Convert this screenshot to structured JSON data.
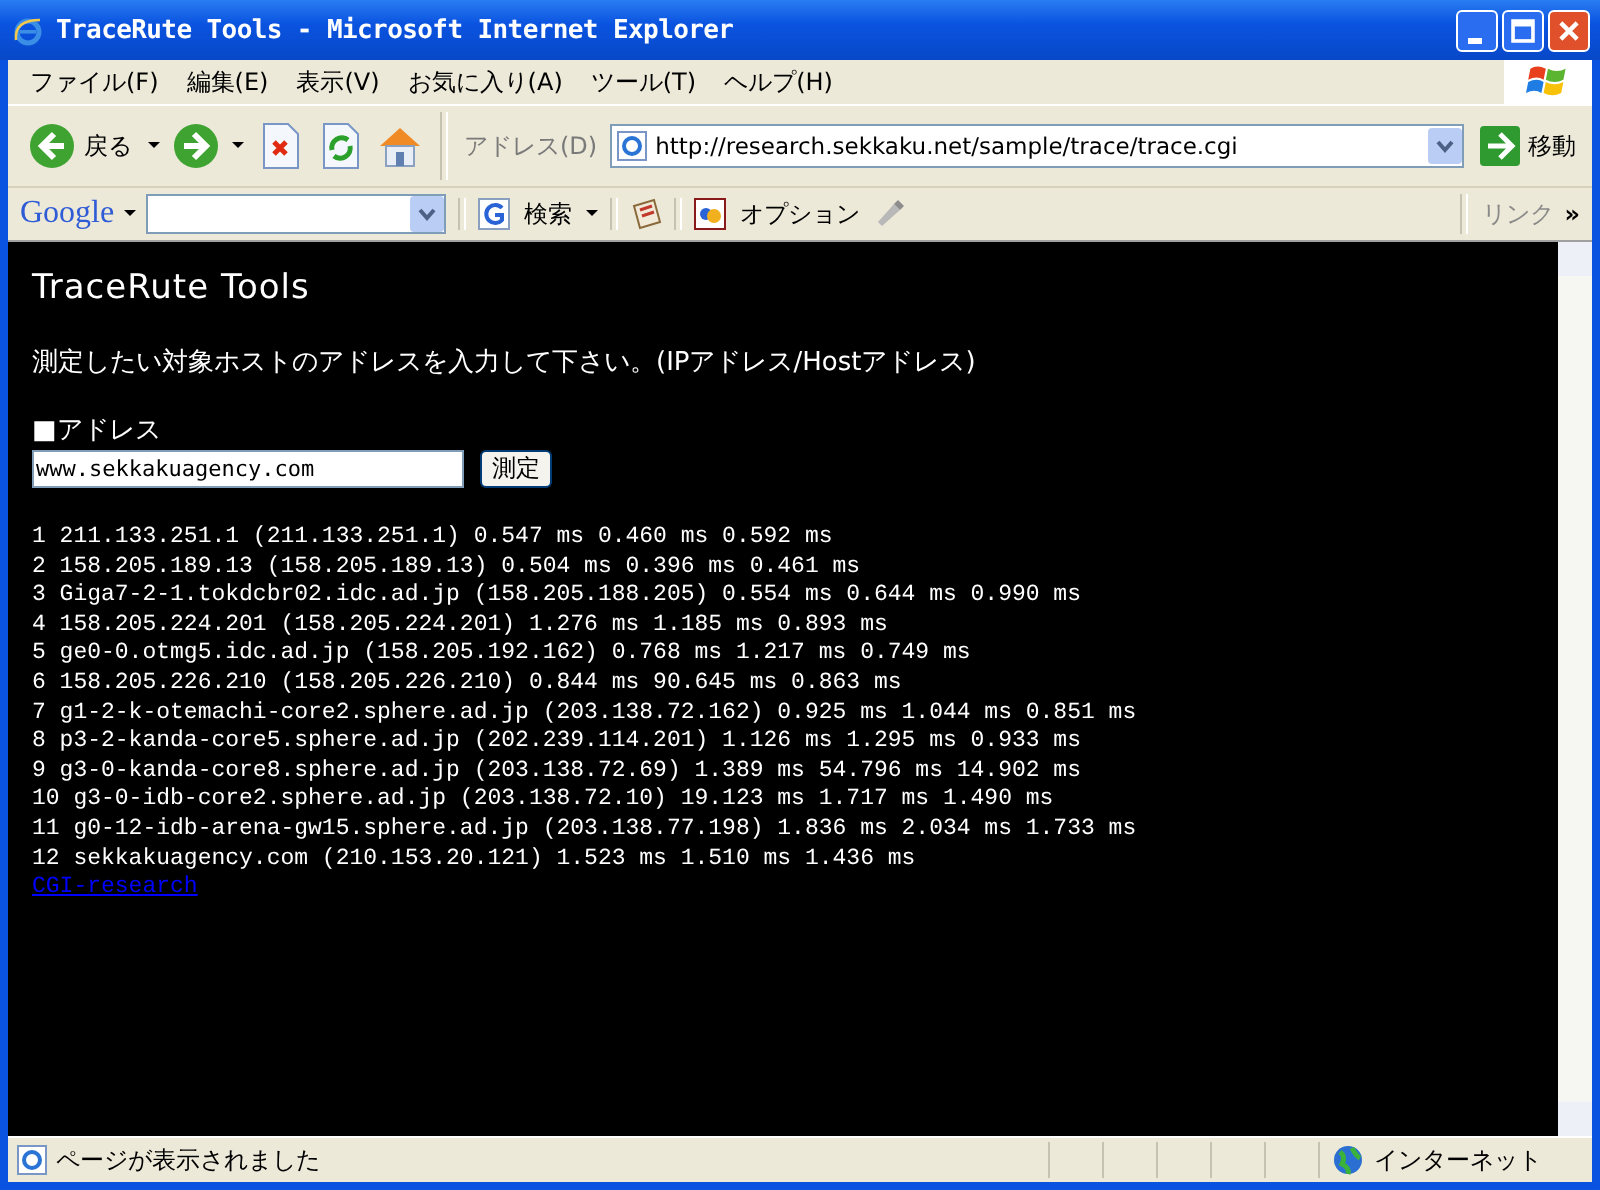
{
  "window": {
    "title": "TraceRute Tools - Microsoft Internet Explorer"
  },
  "menu": [
    "ファイル(F)",
    "編集(E)",
    "表示(V)",
    "お気に入り(A)",
    "ツール(T)",
    "ヘルプ(H)"
  ],
  "toolbar": {
    "back_label": "戻る",
    "address_label": "アドレス(D)",
    "address": "http://research.sekkaku.net/sample/trace/trace.cgi",
    "go_label": "移動"
  },
  "google_bar": {
    "logo": "Google",
    "search_label": "検索",
    "options_label": "オプション",
    "links_label": "リンク",
    "more": "»"
  },
  "page": {
    "heading": "TraceRute Tools",
    "instruction": "測定したい対象ホストのアドレスを入力して下さい。(IPアドレス/Hostアドレス)",
    "address_label": "■アドレス",
    "address_value": "www.sekkakuagency.com",
    "submit": "測定",
    "results": [
      "1 211.133.251.1 (211.133.251.1) 0.547 ms 0.460 ms 0.592 ms",
      "2 158.205.189.13 (158.205.189.13) 0.504 ms 0.396 ms 0.461 ms",
      "3 Giga7-2-1.tokdcbr02.idc.ad.jp (158.205.188.205) 0.554 ms 0.644 ms 0.990 ms",
      "4 158.205.224.201 (158.205.224.201) 1.276 ms 1.185 ms 0.893 ms",
      "5 ge0-0.otmg5.idc.ad.jp (158.205.192.162) 0.768 ms 1.217 ms 0.749 ms",
      "6 158.205.226.210 (158.205.226.210) 0.844 ms 90.645 ms 0.863 ms",
      "7 g1-2-k-otemachi-core2.sphere.ad.jp (203.138.72.162) 0.925 ms 1.044 ms 0.851 ms",
      "8 p3-2-kanda-core5.sphere.ad.jp (202.239.114.201) 1.126 ms 1.295 ms 0.933 ms",
      "9 g3-0-kanda-core8.sphere.ad.jp (203.138.72.69) 1.389 ms 54.796 ms 14.902 ms",
      "10 g3-0-idb-core2.sphere.ad.jp (203.138.72.10) 19.123 ms 1.717 ms 1.490 ms",
      "11 g0-12-idb-arena-gw15.sphere.ad.jp (203.138.77.198) 1.836 ms 2.034 ms 1.733 ms",
      "12 sekkakuagency.com (210.153.20.121) 1.523 ms 1.510 ms 1.436 ms"
    ],
    "link": "CGI-research"
  },
  "status_bar": {
    "message": "ページが表示されました",
    "zone": "インターネット"
  }
}
